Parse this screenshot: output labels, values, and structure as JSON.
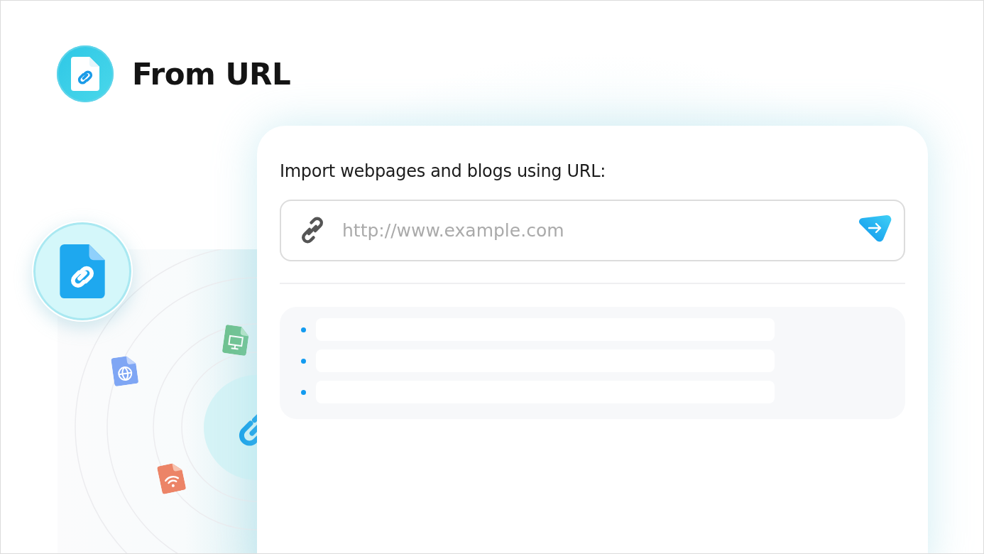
{
  "header": {
    "title": "From URL"
  },
  "import_card": {
    "prompt": "Import webpages and blogs using URL:",
    "url_field": {
      "placeholder": "http://www.example.com"
    },
    "result_lines": [
      {
        "kind": "skeleton"
      },
      {
        "kind": "skeleton"
      },
      {
        "kind": "skeleton"
      }
    ]
  }
}
